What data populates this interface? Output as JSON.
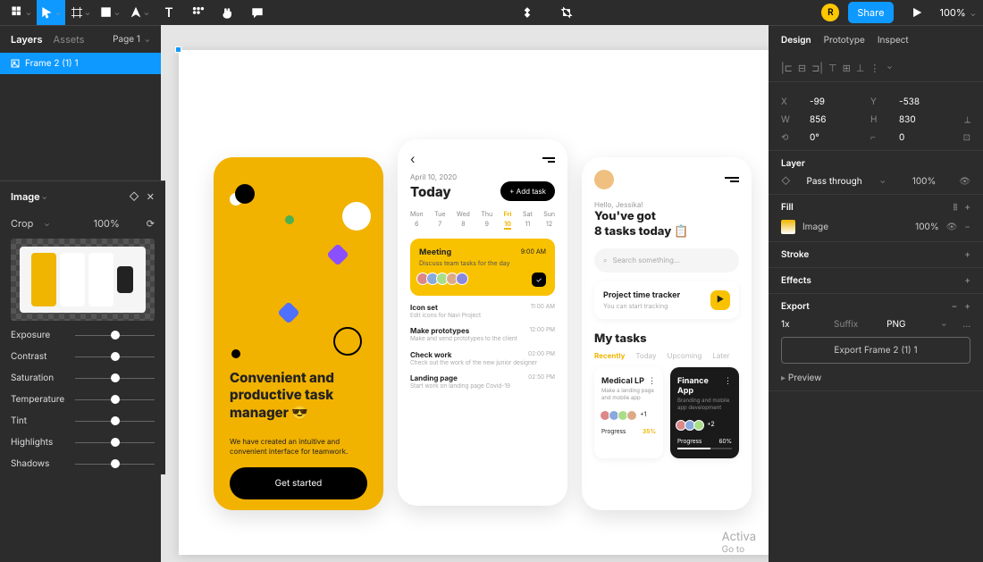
{
  "topbar": {
    "share": "Share",
    "zoom": "100%",
    "avatar_initial": "R"
  },
  "left": {
    "tabs": [
      "Layers",
      "Assets"
    ],
    "page": "Page 1",
    "layer_name": "Frame 2 (1) 1"
  },
  "image_panel": {
    "title": "Image",
    "crop": "Crop",
    "crop_pct": "100%",
    "sliders": [
      "Exposure",
      "Contrast",
      "Saturation",
      "Temperature",
      "Tint",
      "Highlights",
      "Shadows"
    ]
  },
  "canvas": {
    "phone1": {
      "title": "Convenient and productive task manager 😎",
      "sub": "We have created an intuitive and convenient interface for teamwork.",
      "cta": "Get started"
    },
    "phone2": {
      "date": "April 10, 2020",
      "today": "Today",
      "add": "+ Add task",
      "cal_days": [
        "Mon",
        "Tue",
        "Wed",
        "Thu",
        "Fri",
        "Sat",
        "Sun"
      ],
      "cal_nums": [
        "6",
        "7",
        "8",
        "9",
        "10",
        "11",
        "12"
      ],
      "cal_sel_idx": 4,
      "task1": {
        "name": "Meeting",
        "time": "9:00 AM",
        "desc": "Discuss team tasks for the day"
      },
      "minis": [
        {
          "name": "Icon set",
          "time": "11:00 AM",
          "desc": "Edit icons for Navi Project"
        },
        {
          "name": "Make prototypes",
          "time": "12:00 PM",
          "desc": "Make and send prototypes to the client"
        },
        {
          "name": "Check work",
          "time": "02:00 PM",
          "desc": "Check out the work of the new junior designer"
        },
        {
          "name": "Landing page",
          "time": "02:50 PM",
          "desc": "Start work on landing page Covid-19"
        }
      ]
    },
    "phone3": {
      "hello": "Hello, Jessika!",
      "got1": "You've got",
      "got2": "8 tasks today 📋",
      "search": "Search something...",
      "tracker_t": "Project time tracker",
      "tracker_s": "You can start tracking",
      "mytasks": "My tasks",
      "tabs": [
        "Recently",
        "Today",
        "Upcoming",
        "Later"
      ],
      "card1": {
        "t": "Medical LP",
        "d": "Make a landing page and mobile app",
        "pct": "35%",
        "plus": "+1"
      },
      "card2": {
        "t": "Finance App",
        "d": "Branding and mobile app development",
        "pct": "60%",
        "plus": "+2"
      },
      "progress": "Progress"
    }
  },
  "right": {
    "tabs": [
      "Design",
      "Prototype",
      "Inspect"
    ],
    "x": "-99",
    "y": "-538",
    "w": "856",
    "h": "830",
    "rot": "0°",
    "corner": "0",
    "layer_hdr": "Layer",
    "blend": "Pass through",
    "opacity": "100%",
    "fill_hdr": "Fill",
    "fill_name": "Image",
    "fill_pct": "100%",
    "stroke_hdr": "Stroke",
    "effects_hdr": "Effects",
    "export_hdr": "Export",
    "export_scale": "1x",
    "export_suffix": "Suffix",
    "export_type": "PNG",
    "export_btn": "Export Frame 2 (1) 1",
    "preview": "Preview"
  },
  "watermark": {
    "l1": "Activa",
    "l2": "Go to"
  }
}
